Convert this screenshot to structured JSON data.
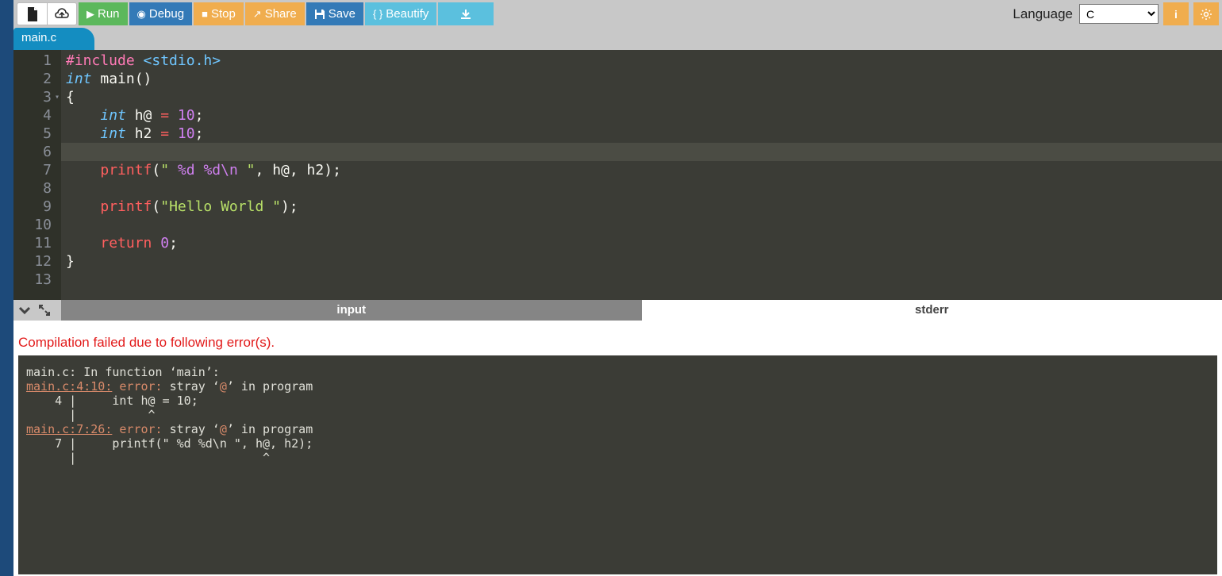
{
  "toolbar": {
    "run_label": "Run",
    "debug_label": "Debug",
    "stop_label": "Stop",
    "share_label": "Share",
    "save_label": "Save",
    "beautify_label": "Beautify",
    "language_label": "Language",
    "language_selected": "C"
  },
  "tab": {
    "filename": "main.c"
  },
  "editor": {
    "line_numbers": [
      "1",
      "2",
      "3",
      "4",
      "5",
      "6",
      "7",
      "8",
      "9",
      "10",
      "11",
      "12",
      "13"
    ],
    "fold_line": 3,
    "active_line_index": 5,
    "lines": [
      [
        {
          "t": "#include ",
          "c": "tok-include"
        },
        {
          "t": "<stdio.h>",
          "c": "tok-header"
        }
      ],
      [
        {
          "t": "int",
          "c": "tok-type"
        },
        {
          "t": " main",
          "c": ""
        },
        {
          "t": "()",
          "c": "tok-paren"
        }
      ],
      [
        {
          "t": "{",
          "c": ""
        }
      ],
      [
        {
          "t": "    ",
          "c": ""
        },
        {
          "t": "int",
          "c": "tok-type"
        },
        {
          "t": " h@ ",
          "c": ""
        },
        {
          "t": "=",
          "c": "tok-keyword"
        },
        {
          "t": " ",
          "c": ""
        },
        {
          "t": "10",
          "c": "tok-num"
        },
        {
          "t": ";",
          "c": ""
        }
      ],
      [
        {
          "t": "    ",
          "c": ""
        },
        {
          "t": "int",
          "c": "tok-type"
        },
        {
          "t": " h2 ",
          "c": ""
        },
        {
          "t": "=",
          "c": "tok-keyword"
        },
        {
          "t": " ",
          "c": ""
        },
        {
          "t": "10",
          "c": "tok-num"
        },
        {
          "t": ";",
          "c": ""
        }
      ],
      [],
      [
        {
          "t": "    ",
          "c": ""
        },
        {
          "t": "printf",
          "c": "tok-func"
        },
        {
          "t": "(",
          "c": "tok-paren"
        },
        {
          "t": "\" ",
          "c": "tok-str"
        },
        {
          "t": "%d",
          "c": "tok-esc"
        },
        {
          "t": " ",
          "c": "tok-str"
        },
        {
          "t": "%d",
          "c": "tok-esc"
        },
        {
          "t": "\\n",
          "c": "tok-esc"
        },
        {
          "t": " \"",
          "c": "tok-str"
        },
        {
          "t": ", h@, h2",
          "c": ""
        },
        {
          "t": ")",
          "c": "tok-paren"
        },
        {
          "t": ";",
          "c": ""
        }
      ],
      [],
      [
        {
          "t": "    ",
          "c": ""
        },
        {
          "t": "printf",
          "c": "tok-func"
        },
        {
          "t": "(",
          "c": "tok-paren"
        },
        {
          "t": "\"Hello World \"",
          "c": "tok-str"
        },
        {
          "t": ")",
          "c": "tok-paren"
        },
        {
          "t": ";",
          "c": ""
        }
      ],
      [],
      [
        {
          "t": "    ",
          "c": ""
        },
        {
          "t": "return",
          "c": "tok-keyword"
        },
        {
          "t": " ",
          "c": ""
        },
        {
          "t": "0",
          "c": "tok-num"
        },
        {
          "t": ";",
          "c": ""
        }
      ],
      [
        {
          "t": "}",
          "c": ""
        }
      ],
      []
    ]
  },
  "output": {
    "tab_input": "input",
    "tab_stderr": "stderr",
    "error_heading": "Compilation failed due to following error(s).",
    "stderr_lines": [
      {
        "segs": [
          {
            "t": "main.c: In function ‘main’:",
            "c": ""
          }
        ]
      },
      {
        "segs": [
          {
            "t": "main.c:4:10:",
            "c": "err-loc"
          },
          {
            "t": " ",
            "c": ""
          },
          {
            "t": "error:",
            "c": "err-word"
          },
          {
            "t": " stray ‘",
            "c": ""
          },
          {
            "t": "@",
            "c": "err-word"
          },
          {
            "t": "’ in program",
            "c": ""
          }
        ]
      },
      {
        "segs": [
          {
            "t": "    4 |     int h@ = 10;",
            "c": ""
          }
        ]
      },
      {
        "segs": [
          {
            "t": "      |          ^",
            "c": ""
          }
        ]
      },
      {
        "segs": [
          {
            "t": "main.c:7:26:",
            "c": "err-loc"
          },
          {
            "t": " ",
            "c": ""
          },
          {
            "t": "error:",
            "c": "err-word"
          },
          {
            "t": " stray ‘",
            "c": ""
          },
          {
            "t": "@",
            "c": "err-word"
          },
          {
            "t": "’ in program",
            "c": ""
          }
        ]
      },
      {
        "segs": [
          {
            "t": "    7 |     printf(\" %d %d\\n \", h@, h2);",
            "c": ""
          }
        ]
      },
      {
        "segs": [
          {
            "t": "      |                          ^",
            "c": ""
          }
        ]
      }
    ]
  }
}
